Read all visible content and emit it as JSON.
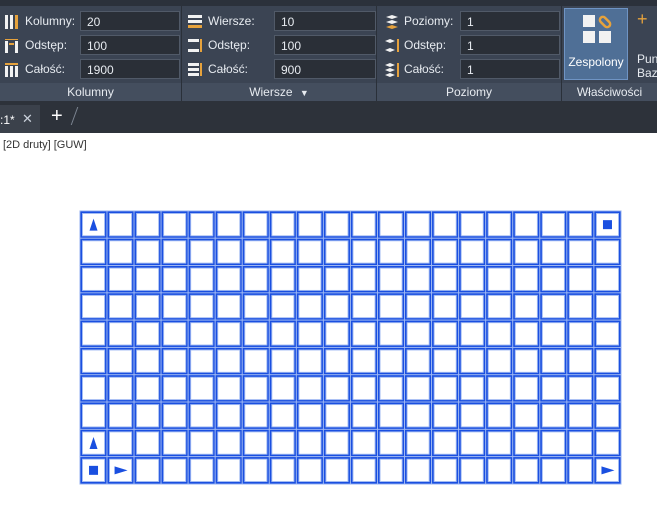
{
  "ribbon": {
    "columns": {
      "title": "Kolumny",
      "rows": [
        {
          "label": "Kolumny:",
          "value": "20",
          "icon": "columns-count-icon"
        },
        {
          "label": "Odstęp:",
          "value": "100",
          "icon": "column-spacing-icon"
        },
        {
          "label": "Całość:",
          "value": "1900",
          "icon": "column-total-icon"
        }
      ]
    },
    "rows": {
      "title": "Wiersze",
      "rows": [
        {
          "label": "Wiersze:",
          "value": "10",
          "icon": "rows-count-icon"
        },
        {
          "label": "Odstęp:",
          "value": "100",
          "icon": "row-spacing-icon"
        },
        {
          "label": "Całość:",
          "value": "900",
          "icon": "row-total-icon"
        }
      ]
    },
    "levels": {
      "title": "Poziomy",
      "rows": [
        {
          "label": "Poziomy:",
          "value": "1",
          "icon": "levels-count-icon"
        },
        {
          "label": "Odstęp:",
          "value": "1",
          "icon": "level-spacing-icon"
        },
        {
          "label": "Całość:",
          "value": "1",
          "icon": "level-total-icon"
        }
      ]
    },
    "properties": {
      "title": "Właściwości",
      "associative_label": "Zespolony",
      "base_point_line1": "Pun",
      "base_point_line2": "Bazo"
    }
  },
  "tabs": {
    "active_label": ":1*",
    "close_glyph": "✕",
    "add_glyph": "+"
  },
  "viewport": {
    "label": "[2D druty] [GUW]"
  },
  "grid": {
    "columns": 20,
    "rows": 10
  },
  "colors": {
    "ribbon_bg": "#3b4453",
    "grid_blue": "#1a4fe0",
    "grid_glow": "#9fb8f2",
    "accent_button": "#4f6f96"
  }
}
